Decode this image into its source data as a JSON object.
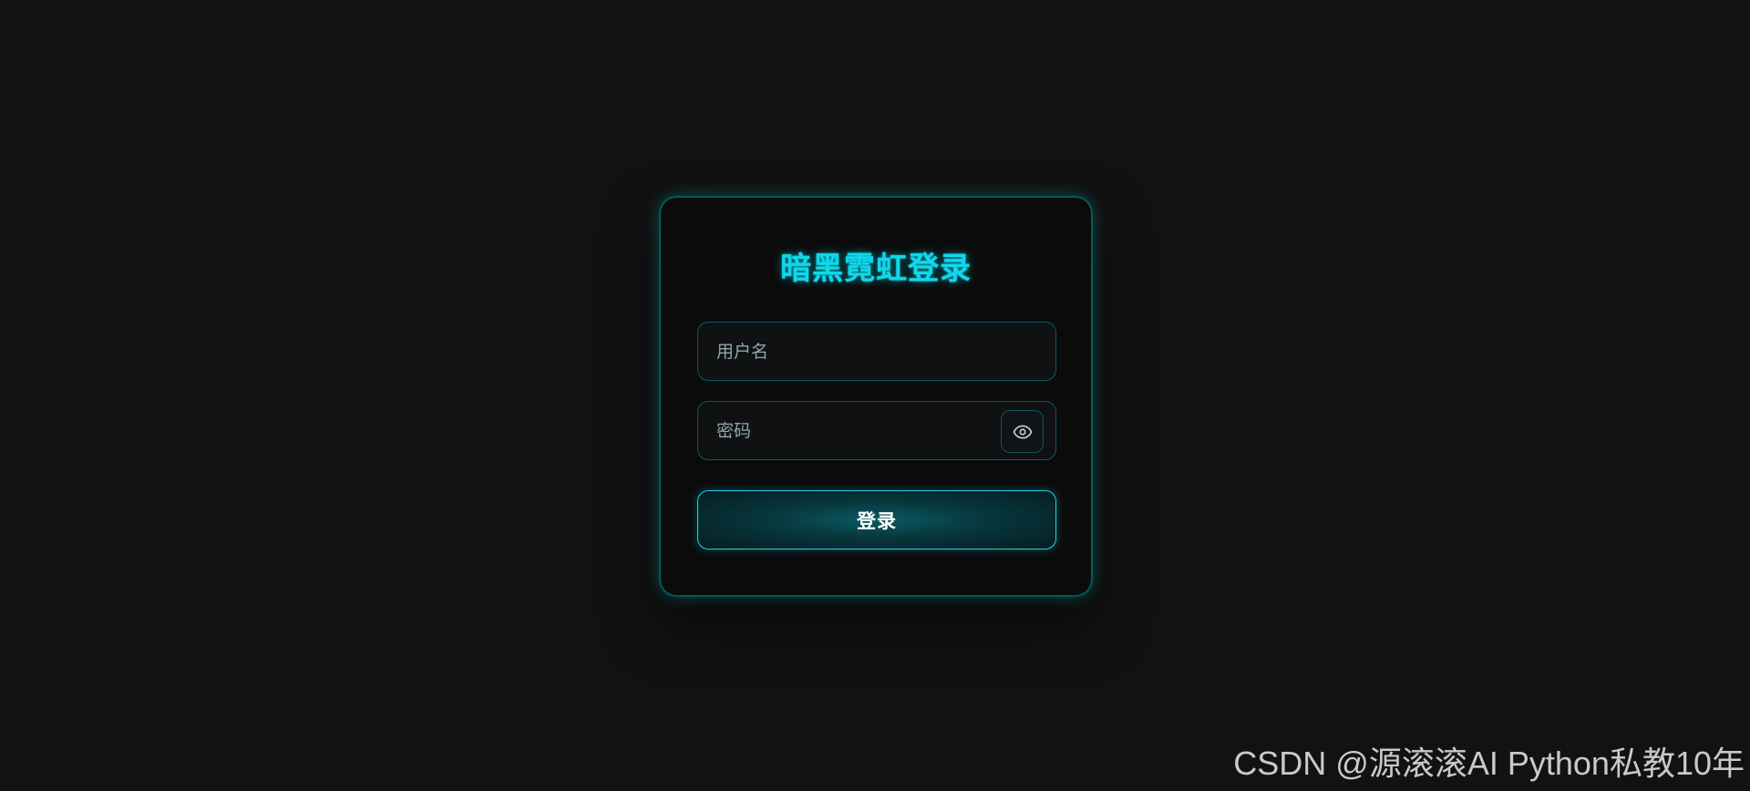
{
  "login_card": {
    "title": "暗黑霓虹登录",
    "username_placeholder": "用户名",
    "password_placeholder": "密码",
    "toggle_password_icon": "eye-icon",
    "submit_label": "登录"
  },
  "watermark": {
    "text": "CSDN @源滚滚AI Python私教10年"
  },
  "colors": {
    "background": "#121212",
    "card": "#0b0b0c",
    "accent": "#12d6ea",
    "button_text": "#ffffff"
  }
}
